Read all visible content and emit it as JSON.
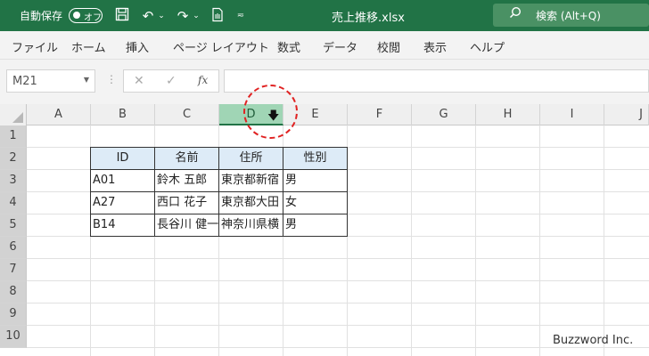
{
  "title_bar": {
    "autosave_label": "自動保存",
    "autosave_state": "オフ",
    "filename": "売上推移.xlsx",
    "search_placeholder": "検索 (Alt+Q)"
  },
  "ribbon": {
    "tabs": [
      "ファイル",
      "ホーム",
      "挿入",
      "ページ レイアウト",
      "数式",
      "データ",
      "校閲",
      "表示",
      "ヘルプ"
    ]
  },
  "formula_bar": {
    "name_box": "M21",
    "fx_label": "fx",
    "formula": ""
  },
  "grid": {
    "columns": [
      "A",
      "B",
      "C",
      "D",
      "E",
      "F",
      "G",
      "H",
      "I",
      "J"
    ],
    "selected_column": "D",
    "rows": [
      "1",
      "2",
      "3",
      "4",
      "5",
      "6",
      "7",
      "8",
      "9",
      "10"
    ],
    "table": {
      "headers": [
        "ID",
        "名前",
        "住所",
        "性別"
      ],
      "rows": [
        [
          "A01",
          "鈴木 五郎",
          "東京都新宿",
          "男"
        ],
        [
          "A27",
          "西口 花子",
          "東京都大田",
          "女"
        ],
        [
          "B14",
          "長谷川 健一",
          "神奈川県横",
          "男"
        ]
      ]
    }
  },
  "watermark": "Buzzword Inc.",
  "colors": {
    "excel_green": "#217346",
    "selected_column": "#a0d5b5",
    "table_header_fill": "#ddebf7",
    "highlight_circle": "#e02222"
  }
}
